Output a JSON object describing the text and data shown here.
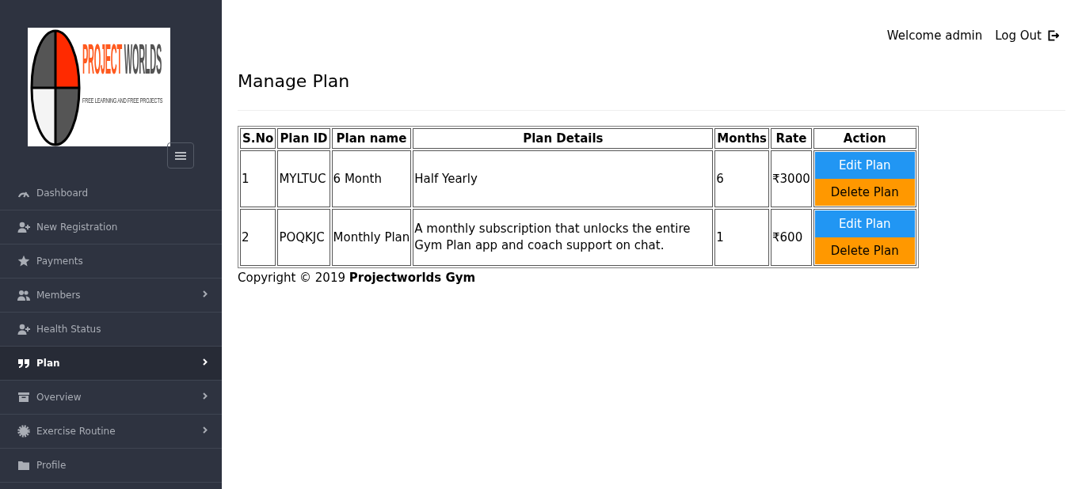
{
  "sidebar": {
    "logo": {
      "title_words": [
        "PROJECT",
        "WORLDS"
      ],
      "tagline": "FREE LEARNING AND FREE PROJECTS"
    },
    "items": [
      {
        "label": "Dashboard",
        "selected": false,
        "expandable": false
      },
      {
        "label": "New Registration",
        "selected": false,
        "expandable": false
      },
      {
        "label": "Payments",
        "selected": false,
        "expandable": false
      },
      {
        "label": "Members",
        "selected": false,
        "expandable": true
      },
      {
        "label": "Health Status",
        "selected": false,
        "expandable": false
      },
      {
        "label": "Plan",
        "selected": true,
        "expandable": true
      },
      {
        "label": "Overview",
        "selected": false,
        "expandable": true
      },
      {
        "label": "Exercise Routine",
        "selected": false,
        "expandable": true
      },
      {
        "label": "Profile",
        "selected": false,
        "expandable": false
      }
    ]
  },
  "header": {
    "welcome": "Welcome admin",
    "logout": "Log Out"
  },
  "page_title": "Manage Plan",
  "table": {
    "columns": [
      "S.No",
      "Plan ID",
      "Plan name",
      "Plan Details",
      "Months",
      "Rate",
      "Action"
    ],
    "rows": [
      {
        "cells": [
          "1",
          "MYLTUC",
          "6 Month",
          "Half Yearly",
          "6",
          "₹3000"
        ],
        "actions": [
          {
            "label": "Edit Plan",
            "kind": "edit"
          },
          {
            "label": "Delete Plan",
            "kind": "delete"
          }
        ]
      },
      {
        "cells": [
          "2",
          "POQKJC",
          "Monthly Plan",
          "A monthly subscription that unlocks the entire Gym Plan app and coach support on chat.",
          "1",
          "₹600"
        ],
        "actions": [
          {
            "label": "Edit Plan",
            "kind": "edit"
          },
          {
            "label": "Delete Plan",
            "kind": "delete"
          }
        ]
      }
    ]
  },
  "footer": {
    "copyright": "Copyright © 2019 **Projectworlds Gym**"
  }
}
